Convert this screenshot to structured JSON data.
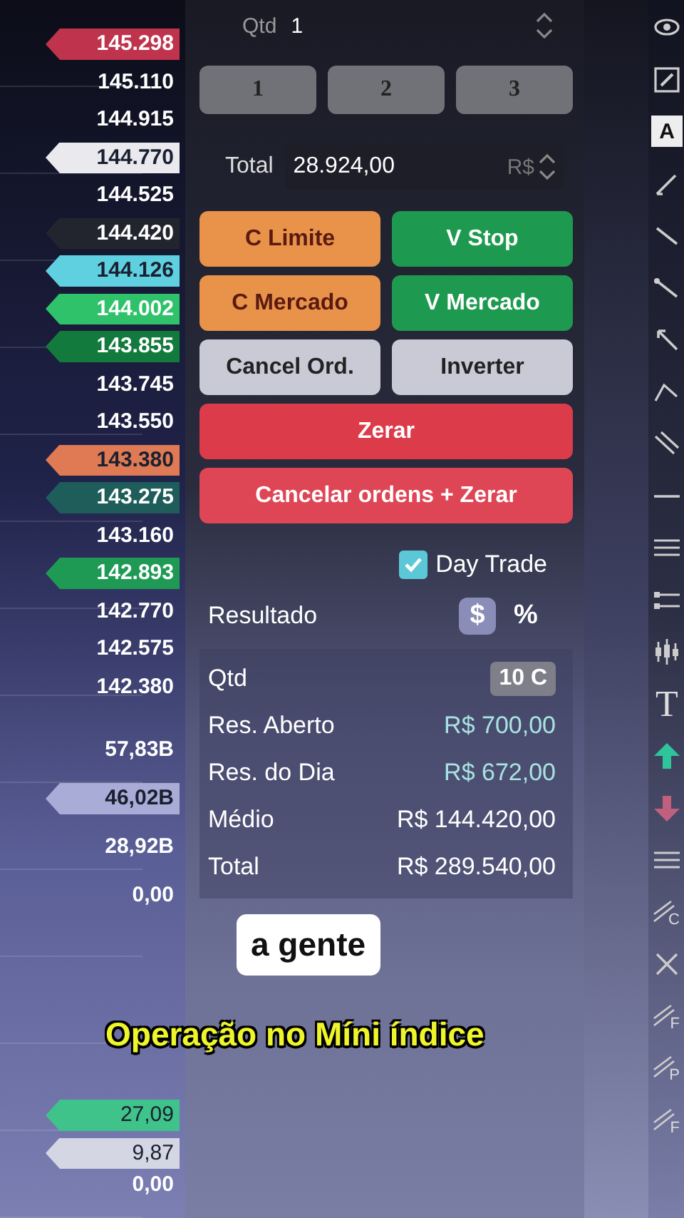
{
  "price_axis": {
    "prices": [
      {
        "text": "145.298",
        "kind": "tag",
        "color": "#c0334c"
      },
      {
        "text": "145.110",
        "kind": "plain"
      },
      {
        "text": "144.915",
        "kind": "plain"
      },
      {
        "text": "144.770",
        "kind": "tag",
        "color": "#e9e9ee"
      },
      {
        "text": "144.525",
        "kind": "plain"
      },
      {
        "text": "144.420",
        "kind": "tag",
        "color": "#23252e"
      },
      {
        "text": "144.126",
        "kind": "tag",
        "color": "#5fd0e0"
      },
      {
        "text": "144.002",
        "kind": "tag",
        "color": "#2fc26a"
      },
      {
        "text": "143.855",
        "kind": "tag",
        "color": "#137a3e"
      },
      {
        "text": "143.745",
        "kind": "plain"
      },
      {
        "text": "143.550",
        "kind": "plain"
      },
      {
        "text": "143.380",
        "kind": "tag",
        "color": "#e07a55"
      },
      {
        "text": "143.275",
        "kind": "tag",
        "color": "#1e5d5a"
      },
      {
        "text": "143.160",
        "kind": "plain"
      },
      {
        "text": "142.893",
        "kind": "tag",
        "color": "#1f9a55"
      },
      {
        "text": "142.770",
        "kind": "plain"
      },
      {
        "text": "142.575",
        "kind": "plain"
      },
      {
        "text": "142.380",
        "kind": "plain"
      }
    ],
    "volumes": [
      {
        "text": "57,83B",
        "kind": "plain"
      },
      {
        "text": "46,02B",
        "kind": "tag",
        "color": "#a9acd6"
      },
      {
        "text": "28,92B",
        "kind": "plain"
      },
      {
        "text": "0,00",
        "kind": "plain"
      }
    ],
    "indicator": [
      {
        "text": "27,09",
        "kind": "tag",
        "color": "#3fc38a"
      },
      {
        "text": "9,87",
        "kind": "tag",
        "color": "#d4d6e4"
      },
      {
        "text": "0,00",
        "kind": "plain"
      }
    ]
  },
  "order_panel": {
    "quantity": {
      "label": "Qtd",
      "value": "1"
    },
    "presets": [
      "1",
      "2",
      "3"
    ],
    "total": {
      "label": "Total",
      "value": "28.924,00",
      "currency": "R$"
    },
    "buttons": [
      {
        "label": "C Limite",
        "color": "#e8924a",
        "wide": false
      },
      {
        "label": "V Stop",
        "color": "#1e9a50",
        "wide": false
      },
      {
        "label": "C Mercado",
        "color": "#e8924a",
        "wide": false
      },
      {
        "label": "V Mercado",
        "color": "#1e9a50",
        "wide": false
      },
      {
        "label": "Cancel Ord.",
        "color": "#c9cad6",
        "wide": false
      },
      {
        "label": "Inverter",
        "color": "#c9cad6",
        "wide": false
      },
      {
        "label": "Zerar",
        "color": "#dc3b4a",
        "wide": true
      },
      {
        "label": "Cancelar ordens + Zerar",
        "color": "#de4656",
        "wide": true
      }
    ],
    "day_trade": {
      "label": "Day Trade",
      "checked": true
    },
    "result": {
      "label": "Resultado",
      "modes": [
        {
          "label": "$",
          "selected": true
        },
        {
          "label": "%",
          "selected": false
        }
      ]
    },
    "position": {
      "quantity_label": "Qtd",
      "quantity_badge": "10 C",
      "rows": [
        {
          "label": "Res. Aberto",
          "value": "R$ 700,00",
          "color": "#a8e3e0"
        },
        {
          "label": "Res. do Dia",
          "value": "R$ 672,00",
          "color": "#a8e3e0"
        },
        {
          "label": "Médio",
          "value": "R$ 144.420,00",
          "color": "#ffffff"
        },
        {
          "label": "Total",
          "value": "R$ 289.540,00",
          "color": "#ffffff"
        }
      ]
    }
  },
  "toolbar": [
    {
      "kind": "eye"
    },
    {
      "kind": "pencil"
    },
    {
      "kind": "letter",
      "glyph": "A"
    },
    {
      "kind": "brush"
    },
    {
      "kind": "line"
    },
    {
      "kind": "ray"
    },
    {
      "kind": "arrow"
    },
    {
      "kind": "angle"
    },
    {
      "kind": "channel"
    },
    {
      "kind": "hline"
    },
    {
      "kind": "lines"
    },
    {
      "kind": "range"
    },
    {
      "kind": "candles"
    },
    {
      "kind": "letter",
      "glyph": "T"
    },
    {
      "kind": "up"
    },
    {
      "kind": "down"
    },
    {
      "kind": "lines"
    },
    {
      "kind": "fib",
      "glyph": "C"
    },
    {
      "kind": "cross"
    },
    {
      "kind": "fib",
      "glyph": "F"
    },
    {
      "kind": "fib",
      "glyph": "P"
    },
    {
      "kind": "fib",
      "glyph": "F"
    }
  ],
  "captions": {
    "label": "a gente",
    "subtitle": "Operação no Míni índice"
  }
}
